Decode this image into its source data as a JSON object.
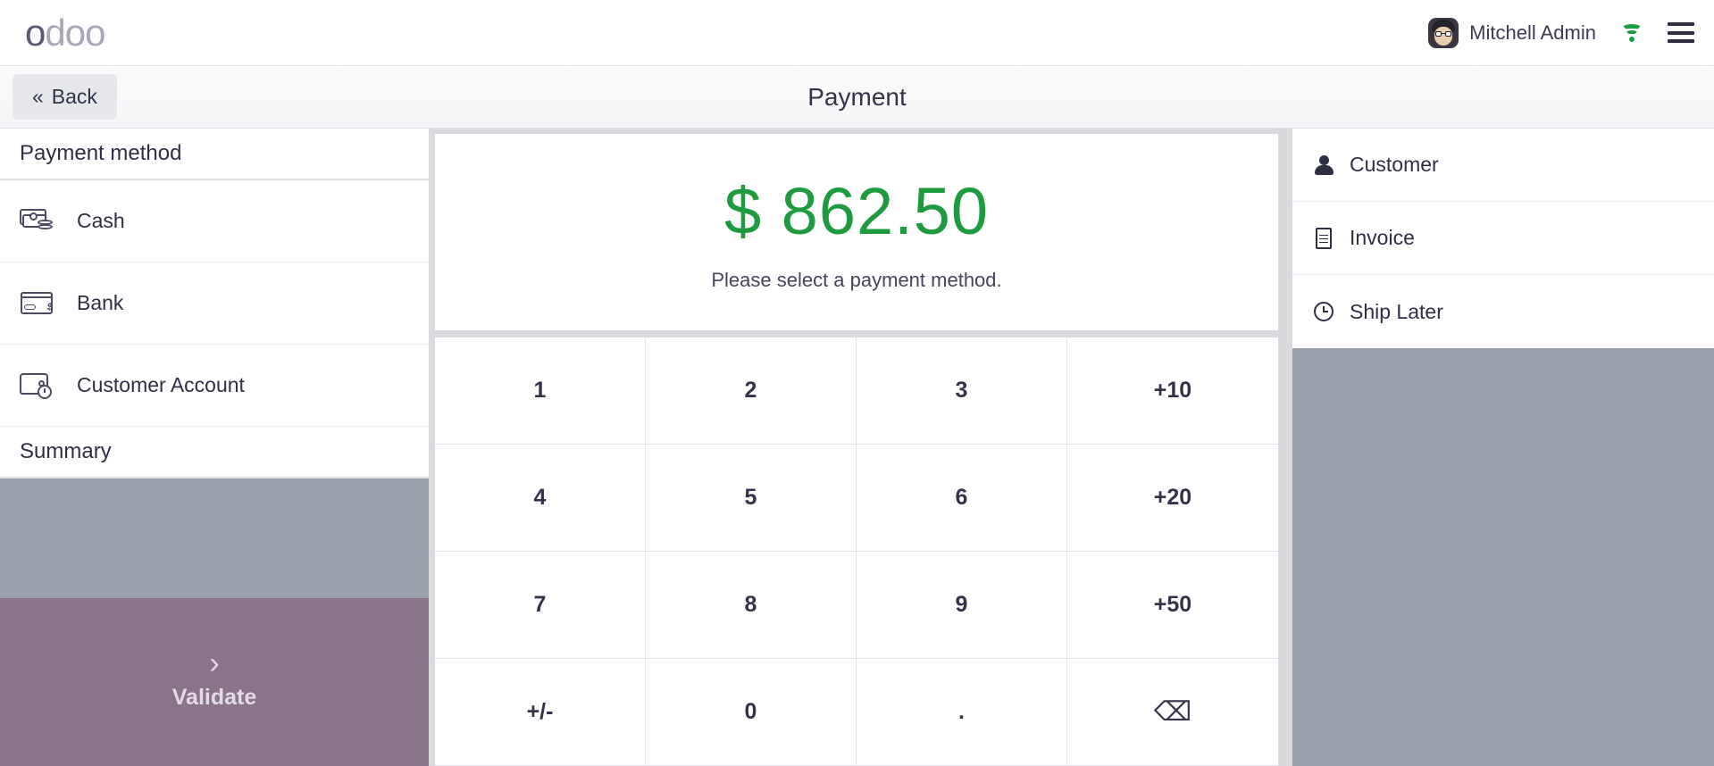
{
  "navbar": {
    "logo_first": "o",
    "logo_rest": "doo",
    "username": "Mitchell Admin",
    "avatar_name": "avatar",
    "wifi_color": "#1a9e3f"
  },
  "subheader": {
    "back_label": "Back",
    "back_chevron": "«",
    "title": "Payment"
  },
  "left": {
    "payment_method_heading": "Payment method",
    "methods": [
      {
        "label": "Cash",
        "icon": "cash-icon"
      },
      {
        "label": "Bank",
        "icon": "credit-card-icon"
      },
      {
        "label": "Customer Account",
        "icon": "wallet-clock-icon"
      }
    ],
    "summary_heading": "Summary",
    "validate_label": "Validate",
    "validate_chevron": "›",
    "validate_color": "#8a7488",
    "panel_fill_color": "#9ba1ac"
  },
  "center": {
    "amount": "$ 862.50",
    "amount_color": "#1f9b3f",
    "hint": "Please select a payment method.",
    "numpad": [
      {
        "label": "1",
        "name": "numpad-key-1"
      },
      {
        "label": "2",
        "name": "numpad-key-2"
      },
      {
        "label": "3",
        "name": "numpad-key-3"
      },
      {
        "label": "+10",
        "name": "numpad-key-plus10"
      },
      {
        "label": "4",
        "name": "numpad-key-4"
      },
      {
        "label": "5",
        "name": "numpad-key-5"
      },
      {
        "label": "6",
        "name": "numpad-key-6"
      },
      {
        "label": "+20",
        "name": "numpad-key-plus20"
      },
      {
        "label": "7",
        "name": "numpad-key-7"
      },
      {
        "label": "8",
        "name": "numpad-key-8"
      },
      {
        "label": "9",
        "name": "numpad-key-9"
      },
      {
        "label": "+50",
        "name": "numpad-key-plus50"
      },
      {
        "label": "+/-",
        "name": "numpad-key-sign"
      },
      {
        "label": "0",
        "name": "numpad-key-0"
      },
      {
        "label": ".",
        "name": "numpad-key-decimal"
      },
      {
        "label": "⌫",
        "name": "numpad-key-backspace"
      }
    ]
  },
  "right": {
    "actions": [
      {
        "label": "Customer",
        "icon": "person-icon"
      },
      {
        "label": "Invoice",
        "icon": "document-icon"
      },
      {
        "label": "Ship Later",
        "icon": "clock-icon"
      }
    ],
    "panel_fill_color": "#9ba1ac"
  }
}
